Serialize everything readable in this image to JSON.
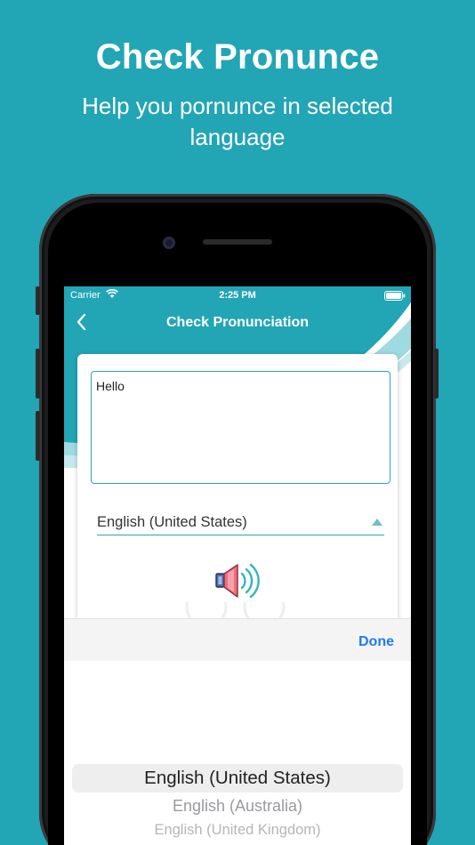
{
  "promo": {
    "title": "Check Pronunce",
    "subtitle": "Help you pornunce in selected language"
  },
  "status_bar": {
    "carrier": "Carrier",
    "time": "2:25 PM"
  },
  "nav": {
    "title": "Check Pronunciation"
  },
  "input": {
    "value": "Hello"
  },
  "language_select": {
    "selected": "English (United States)"
  },
  "toolbar": {
    "done_label": "Done"
  },
  "picker": {
    "options": [
      "English (United States)",
      "English (Australia)",
      "English (United Kingdom)"
    ]
  },
  "colors": {
    "background": "#22a5b5",
    "accent": "#2aa6b3",
    "done_blue": "#1c7cf2"
  },
  "icons": {
    "back": "chevron-left-icon",
    "speaker": "speaker-sound-icon",
    "wifi": "wifi-icon",
    "battery": "battery-icon",
    "dropdown": "triangle-up-icon"
  }
}
